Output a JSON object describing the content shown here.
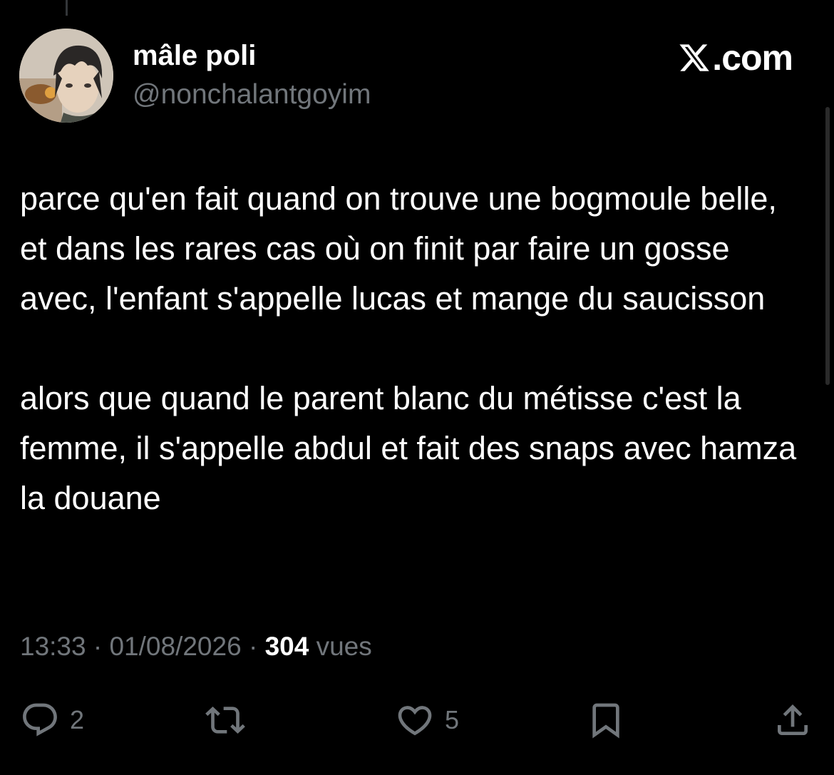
{
  "author": {
    "display_name": "mâle poli",
    "handle": "@nonchalantgoyim"
  },
  "brand": {
    "label": ".com",
    "icon": "x-logo-icon"
  },
  "tweet": {
    "paragraphs": [
      "parce qu'en fait quand on trouve une bogmoule belle, et dans les rares cas où on finit par faire un gosse avec, l'enfant s'appelle lucas et mange du saucisson",
      "alors que quand le parent blanc du métisse c'est la femme, il s'appelle abdul et fait des snaps avec hamza la douane"
    ],
    "time": "13:33",
    "separator": "·",
    "date": "01/08/2026",
    "views_count": "304",
    "views_label": "vues"
  },
  "actions": {
    "reply": {
      "icon": "reply-icon",
      "count": "2"
    },
    "repost": {
      "icon": "repost-icon",
      "count": ""
    },
    "like": {
      "icon": "heart-icon",
      "count": "5"
    },
    "bookmark": {
      "icon": "bookmark-icon",
      "count": ""
    },
    "share": {
      "icon": "share-icon",
      "count": ""
    }
  },
  "colors": {
    "background": "#000000",
    "primary_text": "#ffffff",
    "secondary_text": "#71767b"
  }
}
